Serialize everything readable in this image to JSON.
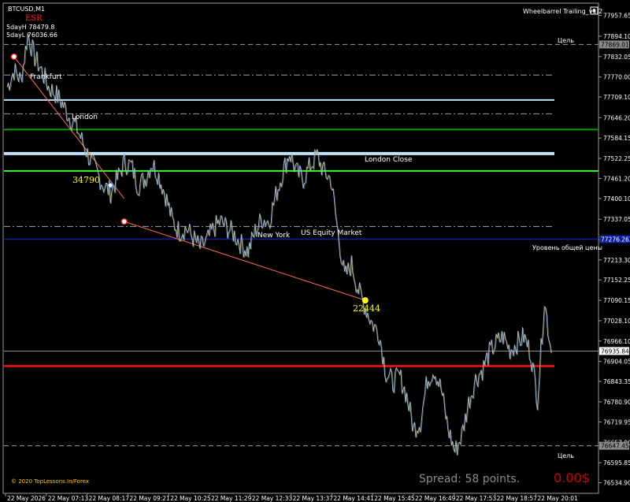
{
  "window": {
    "symbol_title": "BTCUSD,M1",
    "esr_label": "ESR",
    "day_high": "5dayH 78479.8",
    "day_low": "5dayL 76036.66",
    "indicator_name": "Wheelbarrel Trailing_v1.2",
    "copyright": "© 2020 TopLessons.In/Forex",
    "spread_text": "Spread: 58 points.",
    "profit_text": "0.00$"
  },
  "colors": {
    "background": "#000000",
    "price_line": "#9fb8d8",
    "accent_yellow": "#ffff00",
    "green_line": "#00a000",
    "lime_line": "#33ff33",
    "lightblue_band": "#bfe4ff",
    "navy_line": "#1020a0",
    "red_line": "#ff1010",
    "trend_line": "#ff6a4a",
    "target_line": "#a0a0a0",
    "profit_color": "#cc0000"
  },
  "annotations": {
    "sessions": [
      "Frankfurt",
      "London",
      "London Close",
      "New York",
      "US Equity Market"
    ],
    "values": [
      "34790",
      "22444"
    ],
    "level_labels": {
      "target_top": "Цель",
      "target_bottom": "Цель",
      "overall_price": "Уровень общей цены"
    }
  },
  "price_axis": {
    "ticks": [
      "77957.65",
      "77894.10",
      "77832.05",
      "77770.00",
      "77709.10",
      "77646.20",
      "77584.15",
      "77522.25",
      "77461.20",
      "77400.10",
      "77337.05",
      "77276.00",
      "77213.30",
      "77152.25",
      "77090.15",
      "77028.10",
      "76966.10",
      "76904.05",
      "76843.35",
      "76780.90",
      "76719.95",
      "76657.90",
      "76595.85",
      "76534.90"
    ],
    "tag_upper": "77869.01",
    "tag_current": "76935.84",
    "tag_lower": "76647.45",
    "tag_overall": "77276.26"
  },
  "time_axis": {
    "labels": [
      "22 May 2026",
      "22 May 07:13",
      "22 May 08:17",
      "22 May 09:21",
      "22 May 10:25",
      "22 May 11:29",
      "22 May 12:33",
      "22 May 13:37",
      "22 May 14:41",
      "22 May 15:45",
      "22 May 16:49",
      "22 May 17:53",
      "22 May 18:57",
      "22 May 20:01"
    ]
  },
  "chart_data": {
    "type": "line",
    "title": "BTCUSD,M1",
    "ylim": [
      76505,
      77990
    ],
    "x_labels": [
      "22 May 2026",
      "22 May 07:13",
      "22 May 08:17",
      "22 May 09:21",
      "22 May 10:25",
      "22 May 11:29",
      "22 May 12:33",
      "22 May 13:37",
      "22 May 14:41",
      "22 May 15:45",
      "22 May 16:49",
      "22 May 17:53",
      "22 May 18:57",
      "22 May 20:01"
    ],
    "series": [
      {
        "values": [
          77740,
          77790,
          77760,
          77900,
          77830,
          77790,
          77740,
          77720,
          77690,
          77650,
          77620,
          77570,
          77520,
          77480,
          77440,
          77420,
          77460,
          77510,
          77500,
          77440,
          77460,
          77510,
          77470,
          77410,
          77330,
          77300,
          77310,
          77280,
          77250,
          77270,
          77310,
          77330,
          77310,
          77290,
          77260,
          77240,
          77300,
          77340,
          77330,
          77410,
          77480,
          77540,
          77480,
          77460,
          77500,
          77530,
          77480,
          77460,
          77300,
          77160,
          77200,
          77120,
          77070,
          77020,
          76990,
          76870,
          76840,
          76860,
          76800,
          76700,
          76720,
          76850,
          76880,
          76820,
          76700,
          76630,
          76680,
          76780,
          76850,
          76880,
          76930,
          76960,
          76980,
          76940,
          76960,
          76980,
          76930,
          76790,
          77090,
          76930
        ]
      }
    ],
    "horizontal_levels": [
      {
        "name": "target-upper",
        "value": 77869.01
      },
      {
        "name": "dashdot-1",
        "value": 77776
      },
      {
        "name": "lightblue-upper",
        "value": 77700
      },
      {
        "name": "dashdot-2",
        "value": 77658
      },
      {
        "name": "green",
        "value": 77610
      },
      {
        "name": "lightblue-band",
        "value": 77537
      },
      {
        "name": "lime",
        "value": 77484
      },
      {
        "name": "dashdot-3",
        "value": 77315
      },
      {
        "name": "overall-price",
        "value": 77276.26
      },
      {
        "name": "current-price",
        "value": 76935.84
      },
      {
        "name": "red",
        "value": 76890
      },
      {
        "name": "target-lower",
        "value": 76647.45
      }
    ],
    "trend_lines": [
      {
        "from": [
          1,
          77832
        ],
        "to": [
          17,
          77400
        ]
      },
      {
        "from": [
          17,
          77330
        ],
        "to": [
          52,
          77090
        ]
      }
    ],
    "markers": [
      {
        "label": "34790",
        "value": 77440
      },
      {
        "label": "22444",
        "value": 77090
      }
    ]
  }
}
